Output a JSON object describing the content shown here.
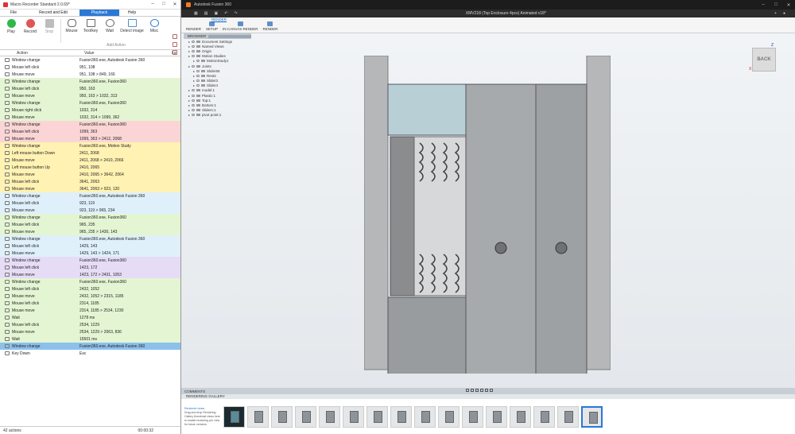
{
  "macro": {
    "title": "Macro Recorder Standard 2.0.69*",
    "menu": [
      "File",
      "Record and Edit",
      "Playback",
      "Help"
    ],
    "ribbon": [
      {
        "label": "Play",
        "icon": "play-icon",
        "color": "#2eb84b"
      },
      {
        "label": "Record",
        "icon": "record-icon",
        "color": "#e05555"
      },
      {
        "label": "Stop",
        "icon": "stop-icon",
        "color": "#bdbdbd"
      },
      {
        "label": "Mouse",
        "icon": "mouse-icon",
        "color": "#666666"
      },
      {
        "label": "Text/key",
        "icon": "keyboard-icon",
        "color": "#666666"
      },
      {
        "label": "Wait",
        "icon": "clock-icon",
        "color": "#666666"
      },
      {
        "label": "Detect image",
        "icon": "image-icon",
        "color": "#4a90d9"
      },
      {
        "label": "Misc",
        "icon": "misc-arrow-icon",
        "color": "#2b78d6"
      }
    ],
    "add_action_label": "Add Action",
    "columns": [
      "Action",
      "Value",
      "La"
    ],
    "rows": [
      {
        "a": "Window change",
        "v": "Fusion360.exe, Autodesk Fusion 360",
        "c": "w"
      },
      {
        "a": "Mouse left click",
        "v": "951, 108",
        "c": "w"
      },
      {
        "a": "Mouse move",
        "v": "951, 108 > 849, 166",
        "c": "w"
      },
      {
        "a": "Window change",
        "v": "Fusion360.exe, Fusion360",
        "c": "g"
      },
      {
        "a": "Mouse left click",
        "v": "950, 163",
        "c": "g"
      },
      {
        "a": "Mouse move",
        "v": "950, 163 > 1032, 313",
        "c": "g"
      },
      {
        "a": "Window change",
        "v": "Fusion360.exe, Fusion360",
        "c": "g"
      },
      {
        "a": "Mouse right click",
        "v": "1032, 314",
        "c": "g"
      },
      {
        "a": "Mouse move",
        "v": "1032, 314 > 1099, 362",
        "c": "g"
      },
      {
        "a": "Window change",
        "v": "Fusion360.exe, Fusion360",
        "c": "r"
      },
      {
        "a": "Mouse left click",
        "v": "1099, 363",
        "c": "r"
      },
      {
        "a": "Mouse move",
        "v": "1099, 363 > 2412, 2068",
        "c": "r"
      },
      {
        "a": "Window change",
        "v": "Fusion360.exe, Motion Study",
        "c": "y"
      },
      {
        "a": "Left mouse button Down",
        "v": "2411, 2068",
        "c": "y"
      },
      {
        "a": "Mouse move",
        "v": "2411, 2068 > 2410, 2066",
        "c": "y"
      },
      {
        "a": "Left mouse button Up",
        "v": "2410, 2065",
        "c": "y"
      },
      {
        "a": "Mouse move",
        "v": "2410, 2065 > 3642, 2064",
        "c": "y"
      },
      {
        "a": "Mouse left click",
        "v": "3641, 2063",
        "c": "y"
      },
      {
        "a": "Mouse move",
        "v": "3641, 2063 > 923, 120",
        "c": "y"
      },
      {
        "a": "Window change",
        "v": "Fusion360.exe, Autodesk Fusion 360",
        "c": "b"
      },
      {
        "a": "Mouse left click",
        "v": "923, 119",
        "c": "b"
      },
      {
        "a": "Mouse move",
        "v": "923, 119 > 965, 234",
        "c": "b"
      },
      {
        "a": "Window change",
        "v": "Fusion360.exe, Fusion360",
        "c": "g"
      },
      {
        "a": "Mouse left click",
        "v": "965, 235",
        "c": "g"
      },
      {
        "a": "Mouse move",
        "v": "965, 235 > 1430, 143",
        "c": "g"
      },
      {
        "a": "Window change",
        "v": "Fusion360.exe, Autodesk Fusion 360",
        "c": "b"
      },
      {
        "a": "Mouse left click",
        "v": "1429, 143",
        "c": "b"
      },
      {
        "a": "Mouse move",
        "v": "1429, 143 > 1424, 171",
        "c": "b"
      },
      {
        "a": "Window change",
        "v": "Fusion360.exe, Fusion360",
        "c": "p"
      },
      {
        "a": "Mouse left click",
        "v": "1423, 172",
        "c": "p"
      },
      {
        "a": "Mouse move",
        "v": "1423, 172 > 2431, 1053",
        "c": "p"
      },
      {
        "a": "Window change",
        "v": "Fusion360.exe, Fusion360",
        "c": "g"
      },
      {
        "a": "Mouse left click",
        "v": "2432, 1052",
        "c": "g"
      },
      {
        "a": "Mouse move",
        "v": "2432, 1052 > 2315, 1185",
        "c": "g"
      },
      {
        "a": "Mouse left click",
        "v": "2314, 1185",
        "c": "g"
      },
      {
        "a": "Mouse move",
        "v": "2314, 1185 > 2534, 1230",
        "c": "g"
      },
      {
        "a": "Wait",
        "v": "1278 ms",
        "c": "g"
      },
      {
        "a": "Mouse left click",
        "v": "2534, 1229",
        "c": "g"
      },
      {
        "a": "Mouse move",
        "v": "2534, 1229 > 2063, 836",
        "c": "g"
      },
      {
        "a": "Wait",
        "v": "15501 ms",
        "c": "g"
      },
      {
        "a": "Window change",
        "v": "Fusion360.exe, Autodesk Fusion 360",
        "c": "s"
      },
      {
        "a": "Key Down",
        "v": "Esc",
        "c": "w"
      }
    ],
    "status_count": "42 actions",
    "status_time": "00:00:32"
  },
  "fusion": {
    "title": "Autodesk Fusion 360",
    "doc_tab": "XMV218 (Top Enclosure 4pcs) Animated v18*",
    "toolbar_tab": "RENDER",
    "toolbar": [
      "RENDER",
      "SETUP",
      "IN-CANVAS RENDER",
      "RENDER"
    ],
    "browser_title": "BROWSER",
    "browser_items": [
      {
        "t": "Document Settings",
        "lvl": 1
      },
      {
        "t": "Named Views",
        "lvl": 1
      },
      {
        "t": "Origin",
        "lvl": 1
      },
      {
        "t": "Motion Studies",
        "lvl": 1
      },
      {
        "t": "MotionStudy1",
        "lvl": 2
      },
      {
        "t": "Joints",
        "lvl": 1
      },
      {
        "t": "Slider55",
        "lvl": 2
      },
      {
        "t": "Rest2",
        "lvl": 2
      },
      {
        "t": "Slider3",
        "lvl": 2
      },
      {
        "t": "Slider4",
        "lvl": 2
      },
      {
        "t": "model:1",
        "lvl": 1
      },
      {
        "t": "Plastic:1",
        "lvl": 1
      },
      {
        "t": "Top:1",
        "lvl": 1
      },
      {
        "t": "Bottom:1",
        "lvl": 1
      },
      {
        "t": "Sliders:1",
        "lvl": 1
      },
      {
        "t": "pivot point:1",
        "lvl": 1
      }
    ],
    "viewcube_label": "BACK",
    "axis_z": "Z",
    "axis_x": "X",
    "comments_label": "COMMENTS",
    "gallery_label": "RENDERING GALLERY",
    "gallery_info": "Drag and drop Rendering Gallery thumbnail views here to enable rendering per view for future versions",
    "gallery_info_title": "Rendered views"
  }
}
